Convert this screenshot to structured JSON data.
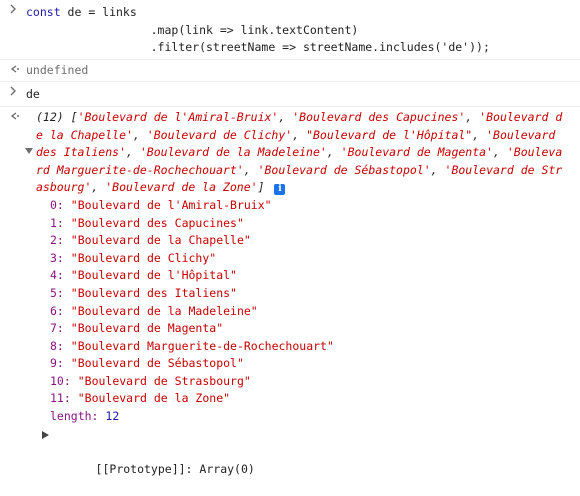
{
  "console": {
    "input1": {
      "line1": {
        "kw": "const",
        "rest": " de = links"
      },
      "line2": "                  .map(link => link.textContent)",
      "line3": "                  .filter(streetName => streetName.includes('de'));"
    },
    "output1": "undefined",
    "input2": "de",
    "array_summary": {
      "count": "(12)",
      "items": [
        "'Boulevard de l'Amiral-Bruix'",
        "'Boulevard des Capucines'",
        "'Boulevard de la Chapelle'",
        "'Boulevard de Clichy'",
        "\"Boulevard de l'Hôpital\"",
        "'Boulevard des Italiens'",
        "'Boulevard de la Madeleine'",
        "'Boulevard de Magenta'",
        "'Boulevard Marguerite-de-Rochechouart'",
        "'Boulevard de Sébastopol'",
        "'Boulevard de Strasbourg'",
        "'Boulevard de la Zone'"
      ],
      "info_badge": "i"
    },
    "entries": [
      {
        "index": "0:",
        "value": "\"Boulevard de l'Amiral-Bruix\""
      },
      {
        "index": "1:",
        "value": "\"Boulevard des Capucines\""
      },
      {
        "index": "2:",
        "value": "\"Boulevard de la Chapelle\""
      },
      {
        "index": "3:",
        "value": "\"Boulevard de Clichy\""
      },
      {
        "index": "4:",
        "value": "\"Boulevard de l'Hôpital\""
      },
      {
        "index": "5:",
        "value": "\"Boulevard des Italiens\""
      },
      {
        "index": "6:",
        "value": "\"Boulevard de la Madeleine\""
      },
      {
        "index": "7:",
        "value": "\"Boulevard de Magenta\""
      },
      {
        "index": "8:",
        "value": "\"Boulevard Marguerite-de-Rochechouart\""
      },
      {
        "index": "9:",
        "value": "\"Boulevard de Sébastopol\""
      },
      {
        "index": "10:",
        "value": "\"Boulevard de Strasbourg\""
      },
      {
        "index": "11:",
        "value": "\"Boulevard de la Zone\""
      }
    ],
    "length_label": "length:",
    "length_value": "12",
    "prototype_label": "[[Prototype]]:",
    "prototype_value": "Array(0)"
  },
  "icons": {
    "input_prompt": "chevron-right-icon",
    "output_arrow": "return-arrow-icon",
    "expand": "triangle-expanded-icon",
    "collapsed": "triangle-collapsed-icon"
  }
}
